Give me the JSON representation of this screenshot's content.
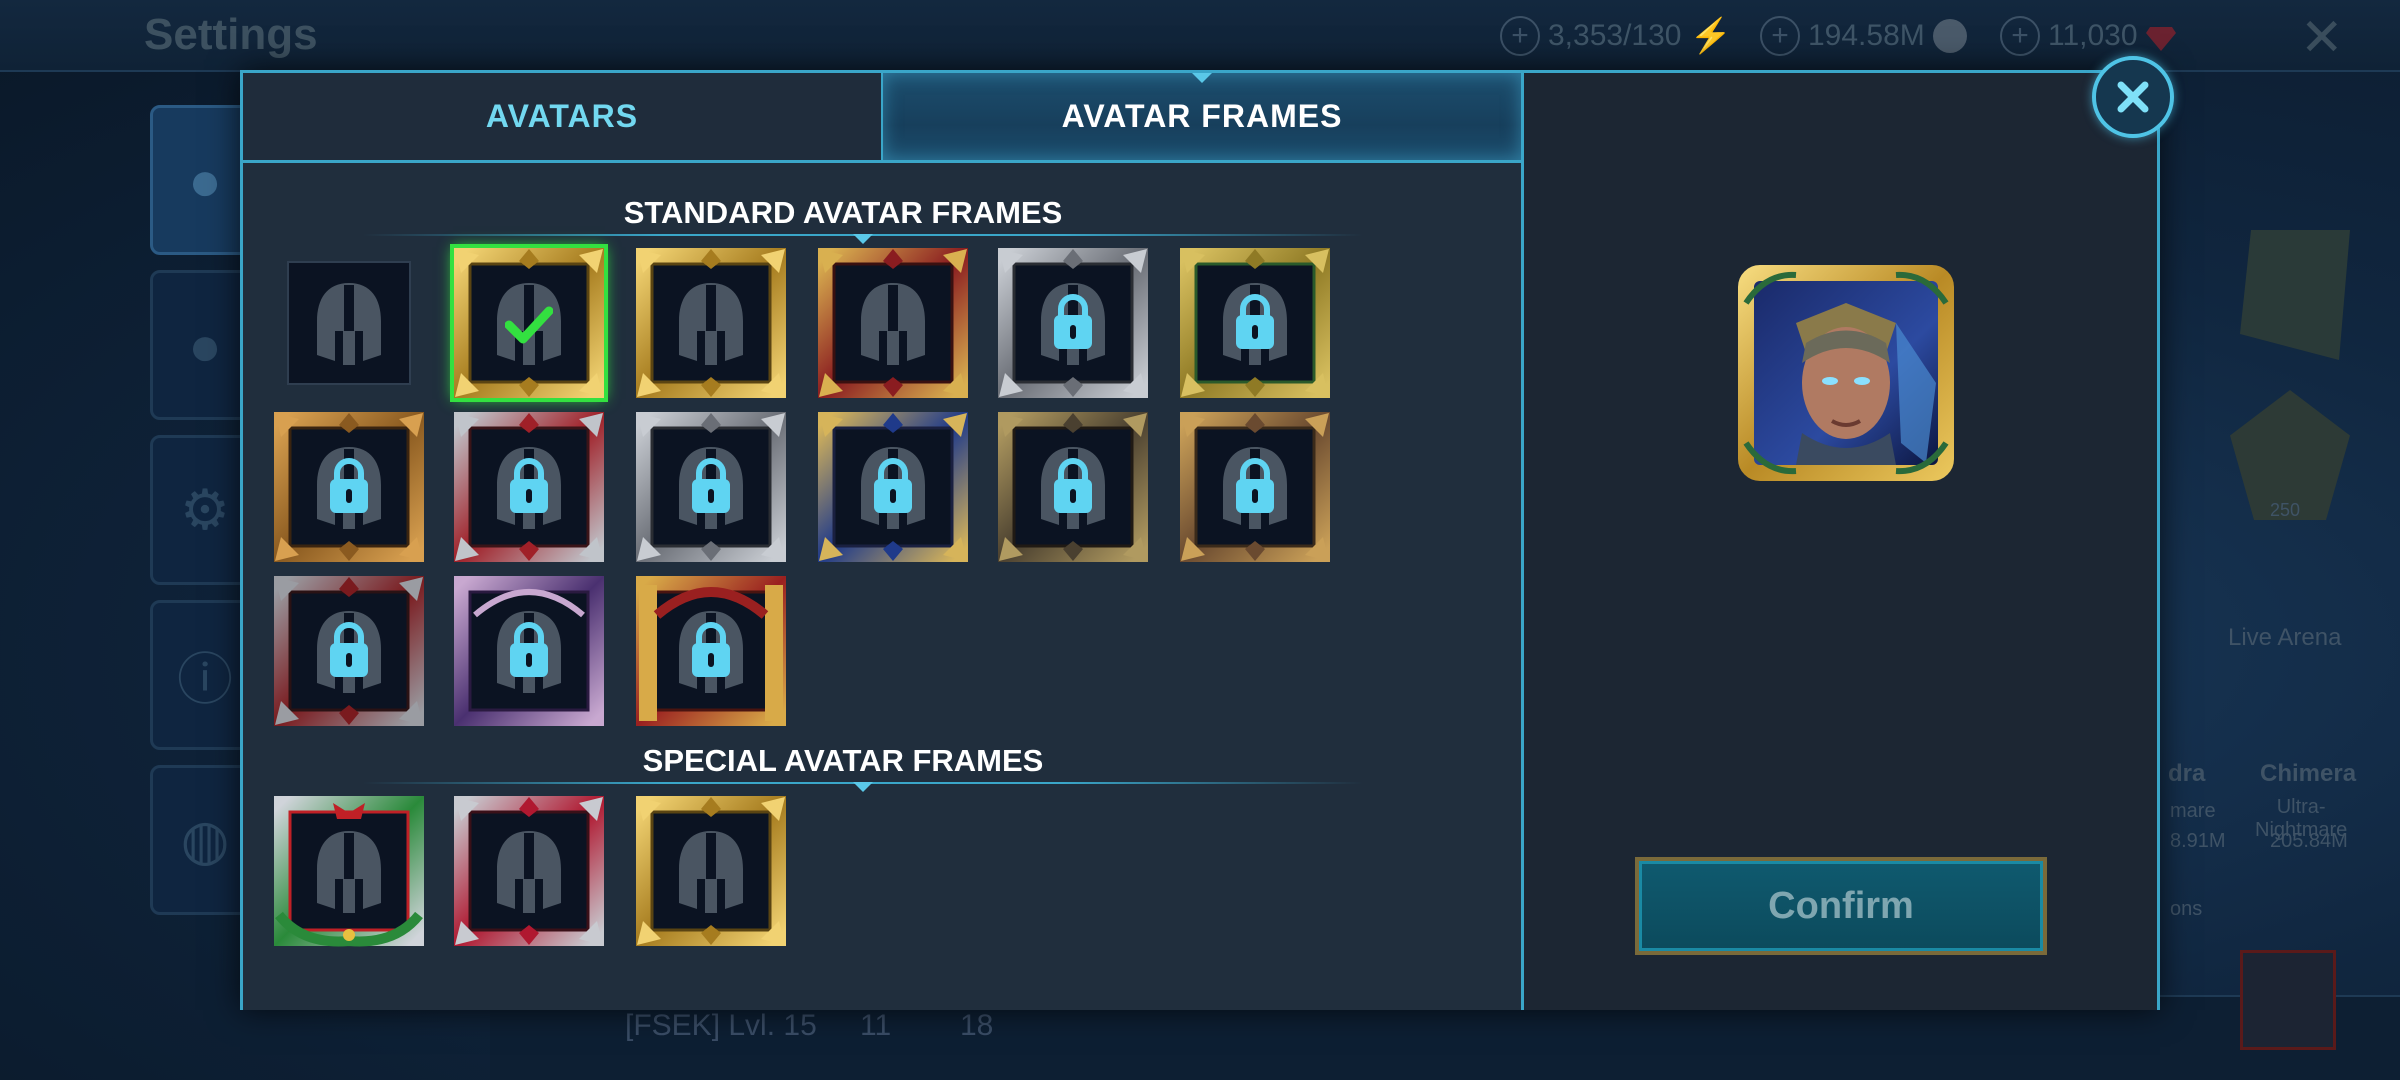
{
  "background": {
    "title": "Settings",
    "resources": [
      {
        "value": "3,353/130",
        "icon": "energy-icon"
      },
      {
        "value": "194.58M",
        "icon": "silver-icon"
      },
      {
        "value": "11,030",
        "icon": "gem-icon"
      }
    ],
    "right_labels": {
      "live_arena": "Live Arena",
      "hydra": "dra",
      "chimera": "Chimera",
      "chimera_diff": "Ultra-\nNightmare",
      "hydra_diff": "mare",
      "hydra_dmg": "8.91M",
      "chimera_dmg": "205.84M",
      "ions": "ons",
      "badge": "250"
    },
    "bottom_text": "[FSEK] Lvl. 15",
    "bottom_trophy1": "11",
    "bottom_trophy2": "18"
  },
  "modal": {
    "tabs": {
      "avatars": "AVATARS",
      "frames": "AVATAR FRAMES"
    },
    "active_tab": "frames",
    "standard_title": "STANDARD AVATAR FRAMES",
    "special_title": "SPECIAL AVATAR FRAMES",
    "confirm_label": "Confirm"
  },
  "colors": {
    "accent": "#3aa6c9",
    "gold": "#c9a23c",
    "silver": "#8a8f96",
    "red": "#9a1f24",
    "lock": "#5fd4f2",
    "selected": "#33e040"
  },
  "standard_frames": [
    {
      "style": "plain",
      "locked": false,
      "selected": false
    },
    {
      "style": "gold",
      "locked": false,
      "selected": true
    },
    {
      "style": "gold",
      "locked": false,
      "selected": false
    },
    {
      "style": "redgold",
      "locked": false,
      "selected": false
    },
    {
      "style": "silver",
      "locked": true,
      "selected": false
    },
    {
      "style": "goldgreen",
      "locked": true,
      "selected": false
    },
    {
      "style": "bronze",
      "locked": true,
      "selected": false
    },
    {
      "style": "redsilver",
      "locked": true,
      "selected": false
    },
    {
      "style": "silver",
      "locked": true,
      "selected": false
    },
    {
      "style": "bluegold",
      "locked": true,
      "selected": false
    },
    {
      "style": "chain",
      "locked": true,
      "selected": false
    },
    {
      "style": "bronzegold",
      "locked": true,
      "selected": false
    },
    {
      "style": "darkred",
      "locked": true,
      "selected": false
    },
    {
      "style": "purple",
      "locked": true,
      "selected": false
    },
    {
      "style": "castle",
      "locked": true,
      "selected": false
    }
  ],
  "special_frames": [
    {
      "style": "holiday",
      "locked": false,
      "selected": false
    },
    {
      "style": "crimson",
      "locked": false,
      "selected": false
    },
    {
      "style": "gold",
      "locked": false,
      "selected": false
    }
  ]
}
